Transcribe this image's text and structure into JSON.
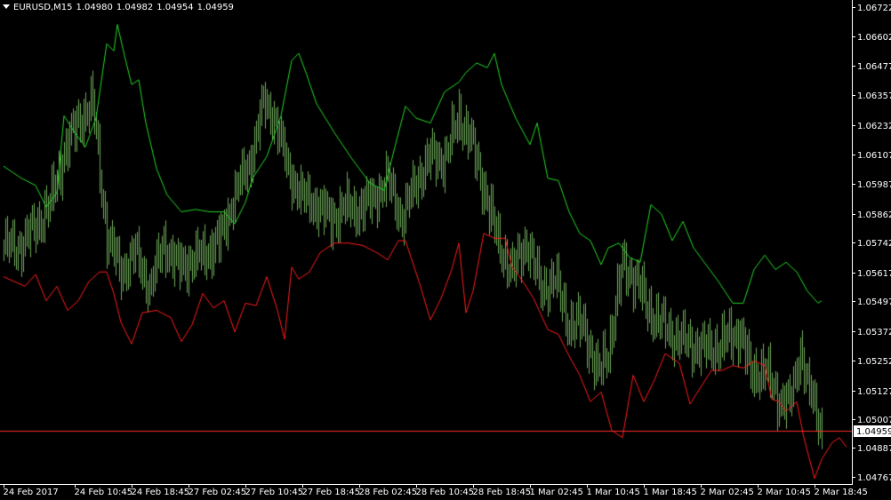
{
  "header": {
    "symbol": "EURUSD,M15",
    "open": "1.04980",
    "high": "1.04982",
    "low": "1.04954",
    "close": "1.04959"
  },
  "colors": {
    "background": "#000000",
    "axis": "#ffffff",
    "upper_band": "#26d726",
    "price_bars": "#6ea85a",
    "lower_band": "#ff1c1c",
    "price_line": "#ff2b2b"
  },
  "chart_data": {
    "type": "line",
    "title": "",
    "xlabel": "",
    "ylabel": "",
    "ylim": [
      1.04737,
      1.06752
    ],
    "y_ticks": [
      "1.06722",
      "1.06602",
      "1.06477",
      "1.06357",
      "1.06232",
      "1.06107",
      "1.05987",
      "1.05862",
      "1.05742",
      "1.05617",
      "1.05497",
      "1.05372",
      "1.05252",
      "1.05127",
      "1.05007",
      "1.04887",
      "1.04767"
    ],
    "x_ticks": [
      {
        "label": "24 Feb 2017",
        "i": 0
      },
      {
        "label": "24 Feb 10:45",
        "i": 40
      },
      {
        "label": "24 Feb 18:45",
        "i": 72
      },
      {
        "label": "27 Feb 02:45",
        "i": 104
      },
      {
        "label": "27 Feb 10:45",
        "i": 136
      },
      {
        "label": "27 Feb 18:45",
        "i": 168
      },
      {
        "label": "28 Feb 02:45",
        "i": 200
      },
      {
        "label": "28 Feb 10:45",
        "i": 232
      },
      {
        "label": "28 Feb 18:45",
        "i": 264
      },
      {
        "label": "1 Mar 02:45",
        "i": 296
      },
      {
        "label": "1 Mar 10:45",
        "i": 328
      },
      {
        "label": "1 Mar 18:45",
        "i": 360
      },
      {
        "label": "2 Mar 02:45",
        "i": 392
      },
      {
        "label": "2 Mar 10:45",
        "i": 424
      },
      {
        "label": "2 Mar 18:45",
        "i": 456
      }
    ],
    "n_bars": 461,
    "current_price": 1.04959,
    "current_price_label": "1.04959",
    "price_anchors": [
      [
        0,
        1.0573
      ],
      [
        8,
        1.0572
      ],
      [
        18,
        1.0581
      ],
      [
        26,
        1.059
      ],
      [
        34,
        1.0612
      ],
      [
        42,
        1.0625
      ],
      [
        50,
        1.0632
      ],
      [
        58,
        1.0577
      ],
      [
        66,
        1.0562
      ],
      [
        74,
        1.057
      ],
      [
        82,
        1.0555
      ],
      [
        90,
        1.0574
      ],
      [
        98,
        1.0564
      ],
      [
        106,
        1.0567
      ],
      [
        114,
        1.057
      ],
      [
        122,
        1.0576
      ],
      [
        130,
        1.0595
      ],
      [
        138,
        1.0607
      ],
      [
        146,
        1.0632
      ],
      [
        152,
        1.0627
      ],
      [
        160,
        1.0604
      ],
      [
        168,
        1.0593
      ],
      [
        176,
        1.059
      ],
      [
        184,
        1.0584
      ],
      [
        192,
        1.0589
      ],
      [
        200,
        1.0588
      ],
      [
        208,
        1.0593
      ],
      [
        216,
        1.06
      ],
      [
        224,
        1.0584
      ],
      [
        232,
        1.06
      ],
      [
        240,
        1.061
      ],
      [
        248,
        1.0609
      ],
      [
        256,
        1.0627
      ],
      [
        262,
        1.0618
      ],
      [
        270,
        1.0597
      ],
      [
        278,
        1.0574
      ],
      [
        286,
        1.0562
      ],
      [
        294,
        1.0575
      ],
      [
        302,
        1.0555
      ],
      [
        310,
        1.0559
      ],
      [
        318,
        1.054
      ],
      [
        326,
        1.054
      ],
      [
        334,
        1.0519
      ],
      [
        340,
        1.053
      ],
      [
        348,
        1.0565
      ],
      [
        356,
        1.0558
      ],
      [
        362,
        1.0547
      ],
      [
        370,
        1.054
      ],
      [
        378,
        1.0535
      ],
      [
        386,
        1.0532
      ],
      [
        394,
        1.053
      ],
      [
        402,
        1.0531
      ],
      [
        408,
        1.0535
      ],
      [
        414,
        1.0537
      ],
      [
        420,
        1.052
      ],
      [
        428,
        1.0521
      ],
      [
        436,
        1.0509
      ],
      [
        442,
        1.0507
      ],
      [
        448,
        1.053
      ],
      [
        452,
        1.0514
      ],
      [
        456,
        1.0506
      ],
      [
        460,
        1.0496
      ]
    ],
    "series": [
      {
        "kind": "bars"
      },
      {
        "kind": "line",
        "values": [
          [
            0,
            1.0606
          ],
          [
            10,
            1.0601
          ],
          [
            18,
            1.0598
          ],
          [
            24,
            1.0589
          ],
          [
            30,
            1.0595
          ],
          [
            34,
            1.0627
          ],
          [
            40,
            1.062
          ],
          [
            46,
            1.0614
          ],
          [
            52,
            1.0626
          ],
          [
            58,
            1.0657
          ],
          [
            62,
            1.0654
          ],
          [
            64,
            1.0665
          ],
          [
            68,
            1.0652
          ],
          [
            72,
            1.064
          ],
          [
            76,
            1.0642
          ],
          [
            80,
            1.0624
          ],
          [
            86,
            1.0605
          ],
          [
            92,
            1.0594
          ],
          [
            100,
            1.0587
          ],
          [
            108,
            1.0588
          ],
          [
            116,
            1.0587
          ],
          [
            124,
            1.0587
          ],
          [
            130,
            1.0582
          ],
          [
            136,
            1.0591
          ],
          [
            140,
            1.0601
          ],
          [
            148,
            1.061
          ],
          [
            156,
            1.0627
          ],
          [
            162,
            1.065
          ],
          [
            166,
            1.0653
          ],
          [
            170,
            1.0645
          ],
          [
            176,
            1.0632
          ],
          [
            186,
            1.062
          ],
          [
            196,
            1.0609
          ],
          [
            206,
            1.0599
          ],
          [
            214,
            1.0596
          ],
          [
            220,
            1.0614
          ],
          [
            226,
            1.0631
          ],
          [
            232,
            1.0626
          ],
          [
            240,
            1.0624
          ],
          [
            248,
            1.0637
          ],
          [
            256,
            1.0641
          ],
          [
            260,
            1.0645
          ],
          [
            266,
            1.0649
          ],
          [
            272,
            1.0647
          ],
          [
            276,
            1.0653
          ],
          [
            280,
            1.064
          ],
          [
            288,
            1.0626
          ],
          [
            296,
            1.0615
          ],
          [
            300,
            1.0624
          ],
          [
            306,
            1.0601
          ],
          [
            312,
            1.06
          ],
          [
            318,
            1.0587
          ],
          [
            324,
            1.0578
          ],
          [
            330,
            1.0575
          ],
          [
            336,
            1.0565
          ],
          [
            340,
            1.0572
          ],
          [
            346,
            1.0574
          ],
          [
            352,
            1.0568
          ],
          [
            358,
            1.0566
          ],
          [
            364,
            1.059
          ],
          [
            370,
            1.0586
          ],
          [
            376,
            1.0575
          ],
          [
            382,
            1.0583
          ],
          [
            388,
            1.0572
          ],
          [
            394,
            1.0566
          ],
          [
            402,
            1.0558
          ],
          [
            410,
            1.0549
          ],
          [
            416,
            1.0549
          ],
          [
            422,
            1.0563
          ],
          [
            428,
            1.0569
          ],
          [
            434,
            1.0563
          ],
          [
            440,
            1.0566
          ],
          [
            446,
            1.0562
          ],
          [
            452,
            1.0554
          ],
          [
            458,
            1.0549
          ],
          [
            460,
            1.055
          ]
        ]
      },
      {
        "kind": "line",
        "values": [
          [
            0,
            1.056
          ],
          [
            6,
            1.0558
          ],
          [
            12,
            1.0556
          ],
          [
            18,
            1.0561
          ],
          [
            24,
            1.055
          ],
          [
            30,
            1.0556
          ],
          [
            36,
            1.0546
          ],
          [
            42,
            1.055
          ],
          [
            48,
            1.0558
          ],
          [
            54,
            1.0562
          ],
          [
            58,
            1.0562
          ],
          [
            62,
            1.0553
          ],
          [
            66,
            1.0541
          ],
          [
            72,
            1.0532
          ],
          [
            78,
            1.0545
          ],
          [
            86,
            1.0546
          ],
          [
            94,
            1.0543
          ],
          [
            100,
            1.0533
          ],
          [
            106,
            1.054
          ],
          [
            112,
            1.0553
          ],
          [
            118,
            1.0547
          ],
          [
            124,
            1.055
          ],
          [
            130,
            1.0537
          ],
          [
            136,
            1.0549
          ],
          [
            142,
            1.0548
          ],
          [
            148,
            1.056
          ],
          [
            154,
            1.0546
          ],
          [
            158,
            1.0534
          ],
          [
            162,
            1.0564
          ],
          [
            166,
            1.0559
          ],
          [
            172,
            1.0562
          ],
          [
            178,
            1.057
          ],
          [
            186,
            1.0574
          ],
          [
            194,
            1.0574
          ],
          [
            202,
            1.0573
          ],
          [
            210,
            1.057
          ],
          [
            216,
            1.0567
          ],
          [
            222,
            1.0575
          ],
          [
            226,
            1.0575
          ],
          [
            234,
            1.0557
          ],
          [
            240,
            1.0542
          ],
          [
            246,
            1.0551
          ],
          [
            252,
            1.0563
          ],
          [
            256,
            1.0574
          ],
          [
            260,
            1.0545
          ],
          [
            264,
            1.0554
          ],
          [
            270,
            1.0578
          ],
          [
            276,
            1.0576
          ],
          [
            282,
            1.0576
          ],
          [
            286,
            1.0564
          ],
          [
            292,
            1.0558
          ],
          [
            298,
            1.0551
          ],
          [
            306,
            1.0538
          ],
          [
            312,
            1.0536
          ],
          [
            318,
            1.0527
          ],
          [
            324,
            1.0519
          ],
          [
            330,
            1.0508
          ],
          [
            336,
            1.0512
          ],
          [
            342,
            1.0496
          ],
          [
            348,
            1.0493
          ],
          [
            354,
            1.0519
          ],
          [
            360,
            1.0508
          ],
          [
            366,
            1.0517
          ],
          [
            372,
            1.0528
          ],
          [
            380,
            1.0524
          ],
          [
            386,
            1.0507
          ],
          [
            392,
            1.0514
          ],
          [
            398,
            1.0521
          ],
          [
            404,
            1.0521
          ],
          [
            410,
            1.0523
          ],
          [
            416,
            1.0522
          ],
          [
            422,
            1.0525
          ],
          [
            428,
            1.0523
          ],
          [
            432,
            1.0509
          ],
          [
            436,
            1.0508
          ],
          [
            440,
            1.0504
          ],
          [
            446,
            1.0508
          ],
          [
            450,
            1.0493
          ],
          [
            456,
            1.0476
          ],
          [
            460,
            1.0484
          ],
          [
            466,
            1.0491
          ],
          [
            470,
            1.0493
          ],
          [
            474,
            1.0489
          ]
        ]
      }
    ]
  }
}
